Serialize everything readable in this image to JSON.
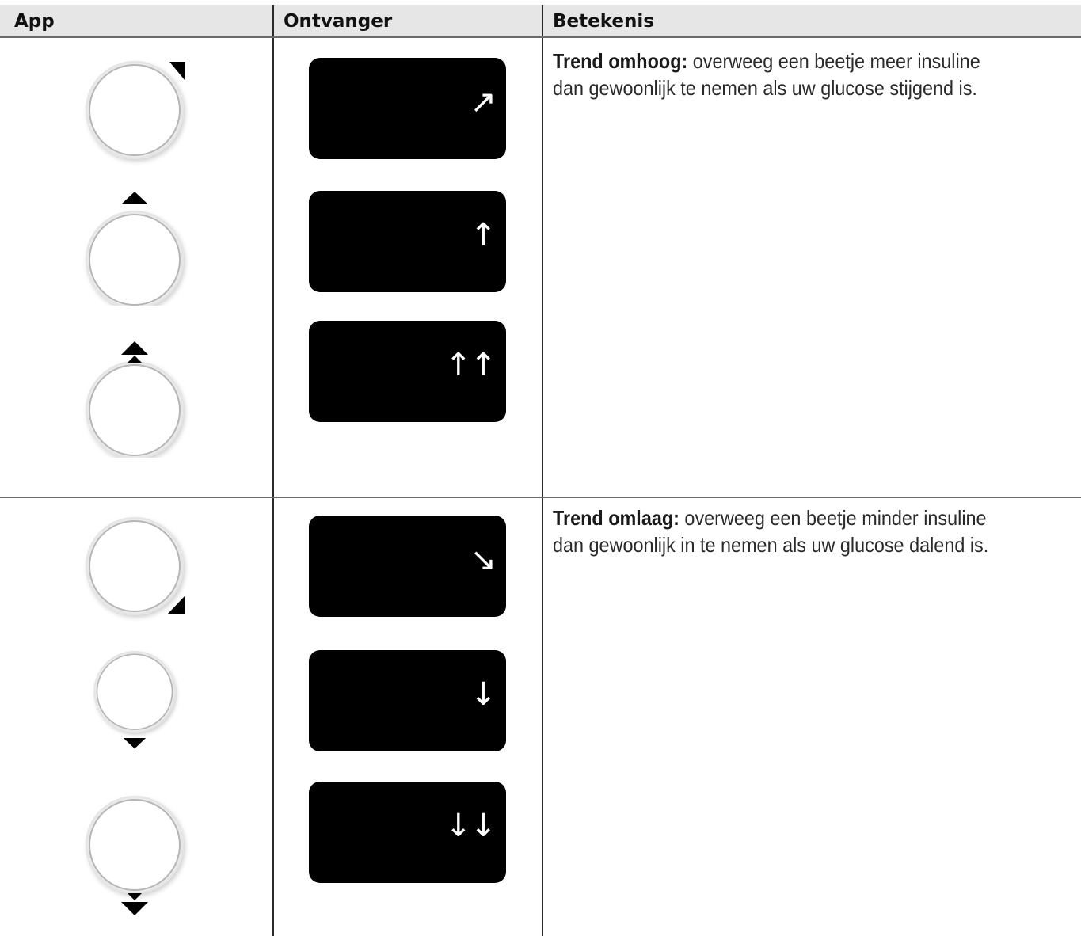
{
  "header": {
    "col_app": "App",
    "col_receiver": "Ontvanger",
    "col_meaning": "Betekenis"
  },
  "rows": [
    {
      "meaning_bold": "Trend omhoog:",
      "meaning_text": " overweeg een beetje meer insuline dan gewoonlijk te nemen als uw glucose stijgend is.",
      "items": [
        {
          "app_icon": "trend-up-diagonal-icon",
          "receiver_arrow": "↗"
        },
        {
          "app_icon": "trend-up-icon",
          "receiver_arrow": "↑"
        },
        {
          "app_icon": "trend-up-double-icon",
          "receiver_arrow": "↑↑"
        }
      ]
    },
    {
      "meaning_bold": "Trend omlaag:",
      "meaning_text": " overweeg een beetje minder insuline dan gewoonlijk in te nemen als uw glucose dalend is.",
      "items": [
        {
          "app_icon": "trend-down-diagonal-icon",
          "receiver_arrow": "↘"
        },
        {
          "app_icon": "trend-down-icon",
          "receiver_arrow": "↓"
        },
        {
          "app_icon": "trend-down-double-icon",
          "receiver_arrow": "↓↓"
        }
      ]
    }
  ]
}
